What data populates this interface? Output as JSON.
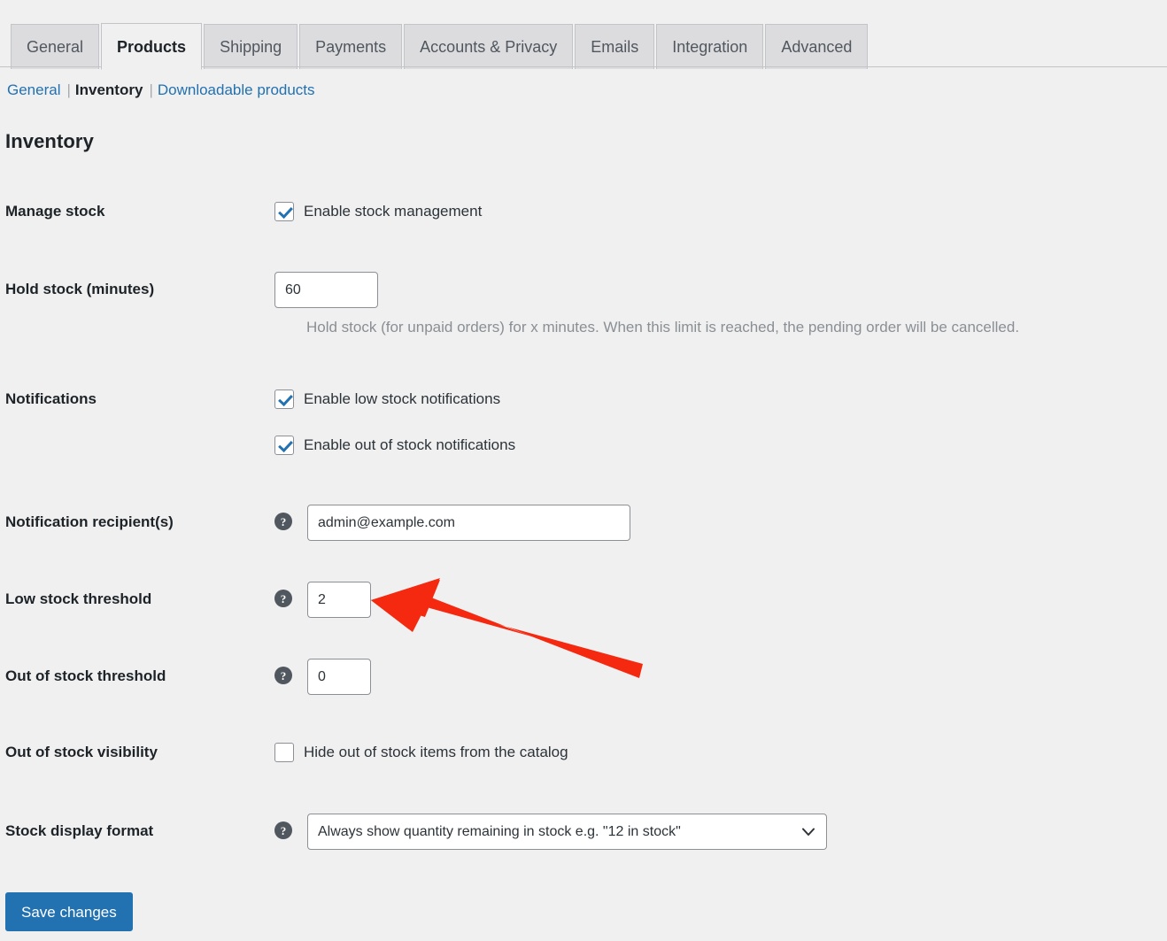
{
  "tabs": [
    {
      "label": "General",
      "active": false
    },
    {
      "label": "Products",
      "active": true
    },
    {
      "label": "Shipping",
      "active": false
    },
    {
      "label": "Payments",
      "active": false
    },
    {
      "label": "Accounts & Privacy",
      "active": false
    },
    {
      "label": "Emails",
      "active": false
    },
    {
      "label": "Integration",
      "active": false
    },
    {
      "label": "Advanced",
      "active": false
    }
  ],
  "subnav": {
    "items": [
      {
        "label": "General",
        "current": false
      },
      {
        "label": "Inventory",
        "current": true
      },
      {
        "label": "Downloadable products",
        "current": false
      }
    ],
    "separator": "|"
  },
  "heading": "Inventory",
  "rows": {
    "manage_stock": {
      "label": "Manage stock",
      "checkbox_label": "Enable stock management",
      "checked": true
    },
    "hold_stock": {
      "label": "Hold stock (minutes)",
      "value": "60",
      "description": "Hold stock (for unpaid orders) for x minutes. When this limit is reached, the pending order will be cancelled."
    },
    "notifications": {
      "label": "Notifications",
      "options": [
        {
          "label": "Enable low stock notifications",
          "checked": true
        },
        {
          "label": "Enable out of stock notifications",
          "checked": true
        }
      ]
    },
    "notification_recipients": {
      "label": "Notification recipient(s)",
      "help_icon": "help-icon",
      "value": "admin@example.com"
    },
    "low_stock_threshold": {
      "label": "Low stock threshold",
      "help_icon": "help-icon",
      "value": "2"
    },
    "out_of_stock_threshold": {
      "label": "Out of stock threshold",
      "help_icon": "help-icon",
      "value": "0"
    },
    "out_of_stock_visibility": {
      "label": "Out of stock visibility",
      "checkbox_label": "Hide out of stock items from the catalog",
      "checked": false
    },
    "stock_display_format": {
      "label": "Stock display format",
      "help_icon": "help-icon",
      "selected": "Always show quantity remaining in stock e.g. \"12 in stock\"",
      "chevron_icon": "chevron-down-icon"
    }
  },
  "save_button": "Save changes",
  "annotation": {
    "type": "arrow",
    "color": "#f4290f",
    "points_to": "low-stock-threshold-input"
  },
  "colors": {
    "page_background": "#f0f0f1",
    "accent_blue": "#2271b1",
    "text_dark": "#1d2327",
    "text_muted": "#8a8f94",
    "border_gray": "#8c8f94",
    "tab_inactive": "#dcdcde",
    "annotation_red": "#f4290f"
  }
}
